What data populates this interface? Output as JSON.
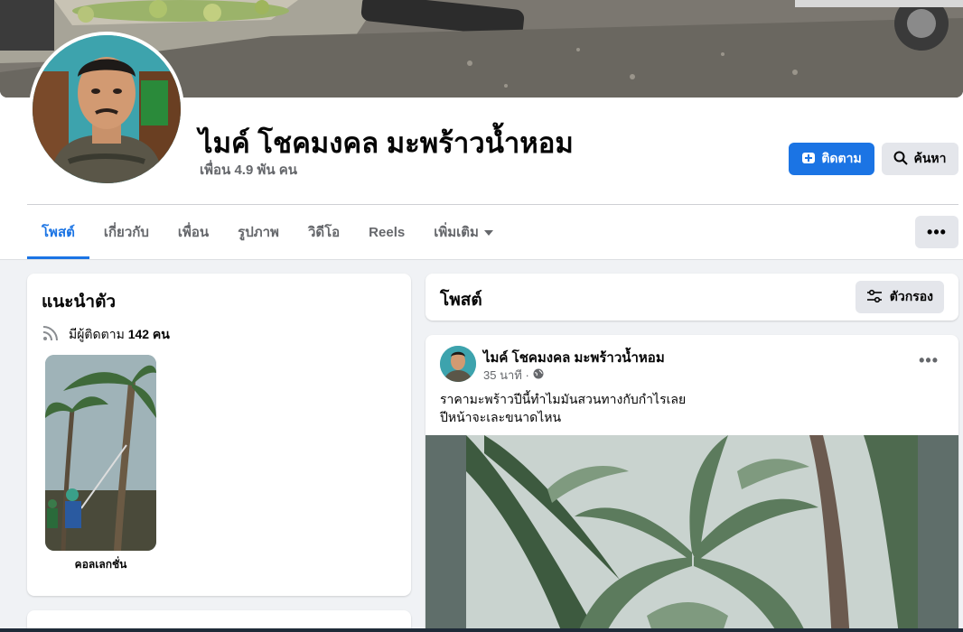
{
  "profile": {
    "name": "ไมค์ โชคมงคล มะพร้าวน้ำหอม",
    "friends": "เพื่อน 4.9 พัน คน"
  },
  "actions": {
    "follow_label": "ติดตาม",
    "search_label": "ค้นหา",
    "more_label": "•••"
  },
  "tabs": [
    {
      "label": "โพสต์",
      "active": true
    },
    {
      "label": "เกี่ยวกับ"
    },
    {
      "label": "เพื่อน"
    },
    {
      "label": "รูปภาพ"
    },
    {
      "label": "วิดีโอ"
    },
    {
      "label": "Reels"
    },
    {
      "label": "เพิ่มเติม"
    }
  ],
  "intro": {
    "title": "แนะนำตัว",
    "followers_prefix": "มีผู้ติดตาม",
    "followers_count": "142 คน",
    "collection_label": "คอลเลกชั่น"
  },
  "posts_section": {
    "title": "โพสต์",
    "filter_label": "ตัวกรอง"
  },
  "post": {
    "author": "ไมค์ โชคมงคล มะพร้าวน้ำหอม",
    "time": "35 นาที ·",
    "text_line1": "ราคามะพร้าวปีนี้ทำไมมันสวนทางกับกำไรเลย",
    "text_line2": "ปีหน้าจะเละขนาดไหน",
    "options": "•••"
  },
  "colors": {
    "accent": "#1b74e4",
    "button_gray": "#e4e6eb",
    "background": "#f0f2f5",
    "secondary_text": "#65676b"
  },
  "icons": [
    "follow-icon",
    "search-icon",
    "caret-down-icon",
    "rss-icon",
    "filter-icon",
    "globe-icon"
  ]
}
